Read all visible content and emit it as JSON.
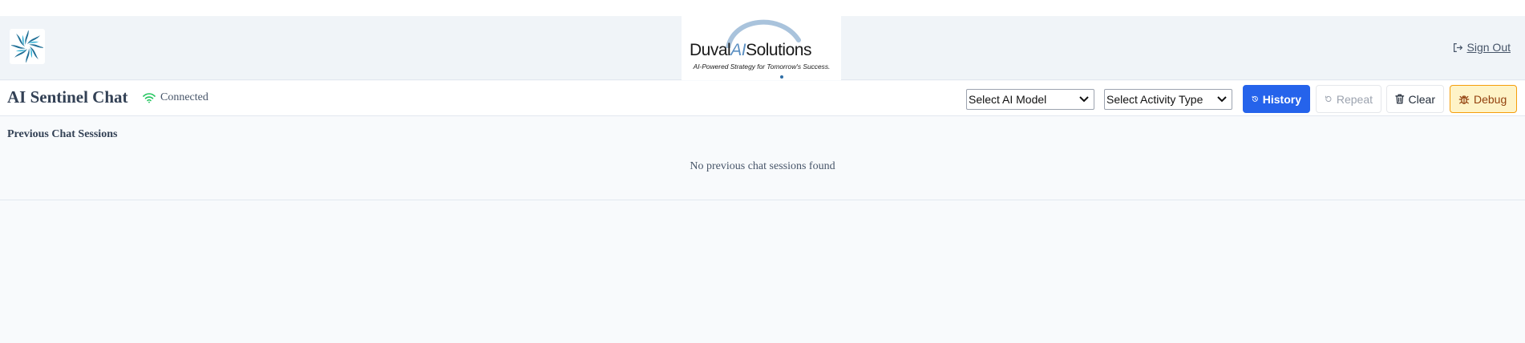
{
  "brand": {
    "name_prefix": "Duv",
    "name_accent_letter": "a",
    "name_l": "l",
    "name_ai": "AI",
    "name_suffix": "Solutions",
    "tagline": "AI-Powered Strategy for Tomorrow's Success."
  },
  "header": {
    "signout_label": "Sign Out"
  },
  "toolbar": {
    "title": "AI Sentinel Chat",
    "status": "Connected",
    "model_select": {
      "value": "Select AI Model"
    },
    "activity_select": {
      "value": "Select Activity Type"
    },
    "history_label": "History",
    "repeat_label": "Repeat",
    "clear_label": "Clear",
    "debug_label": "Debug"
  },
  "history": {
    "title": "Previous Chat Sessions",
    "empty_message": "No previous chat sessions found"
  },
  "colors": {
    "primary": "#2563eb",
    "connected": "#22c55e",
    "debug_bg": "#fef3c7",
    "debug_border": "#f59e0b",
    "brand_blue": "#5b8fc2"
  },
  "icons": {
    "app_logo": "spiral-logo-icon",
    "signout": "sign-out-icon",
    "status": "wifi-icon",
    "history": "clock-history-icon",
    "repeat": "refresh-icon",
    "clear": "trash-icon",
    "debug": "bug-icon",
    "select_chevron": "chevron-down-icon"
  }
}
